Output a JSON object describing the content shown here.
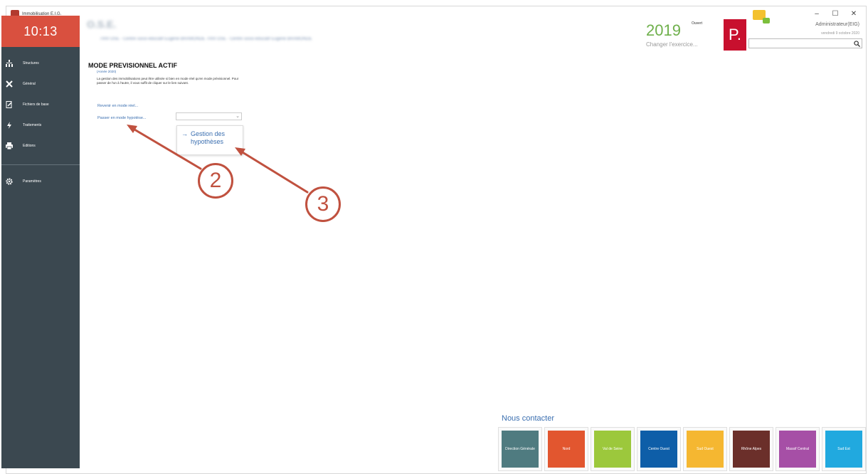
{
  "window": {
    "title": "Immobilisation E.I.G.",
    "controls": [
      "–",
      "☐",
      "✕"
    ]
  },
  "sidebar": {
    "clock": "10:13",
    "items": [
      {
        "label": "Structures",
        "icon": "structure-icon"
      },
      {
        "label": "Général",
        "icon": "tools-icon"
      },
      {
        "label": "Fichiers de base",
        "icon": "edit-file-icon"
      },
      {
        "label": "Traitements",
        "icon": "lightning-icon"
      },
      {
        "label": "Editions",
        "icon": "printer-icon"
      },
      {
        "label": "Paramètres",
        "icon": "gear-icon"
      }
    ]
  },
  "header": {
    "company_name": "O.S.E.",
    "company_subtitle": "7000 OSE - Centre socio-éducatif Eugène BRAMONDE 7000 OSE - Centre socio-éducatif Eugène BRAMONDE",
    "year": "2019",
    "year_status": "Ouvert",
    "change_year": "Changer l'exercice...",
    "logo_letter": "P.",
    "user": "Administrateur(EIG)",
    "date": "vendredi 9 octobre 2020",
    "search_value": ""
  },
  "main": {
    "title": "MODE PREVISIONNEL ACTIF",
    "year_note": "(Année 2020)",
    "description": "La gestion des immobilisations peut être utilisée si bien en mode réel qu'en mode prévisionnel. Pour passer de l'un à l'autre, il vous suffit de cliquer sur le lien suivant.",
    "link_real": "Revenir en mode réel...",
    "link_hypo": "Passer en mode hypotèse...",
    "select_value": "",
    "dropdown_item": "Gestion des hypothèses"
  },
  "annotations": {
    "callout_2": "2",
    "callout_3": "3",
    "color": "#c0513f"
  },
  "contact": {
    "title": "Nous contacter",
    "tiles": [
      {
        "label": "Direction Générale",
        "color": "#4f7b80"
      },
      {
        "label": "Nord",
        "color": "#e2562f"
      },
      {
        "label": "Val de Seine",
        "color": "#9cc83c"
      },
      {
        "label": "Centre Ouest",
        "color": "#0e5ea8"
      },
      {
        "label": "Sud Ouest",
        "color": "#f5b731"
      },
      {
        "label": "Rhône Alpes",
        "color": "#6b2f2a"
      },
      {
        "label": "Massif Central",
        "color": "#a64fa6"
      },
      {
        "label": "Sud Est",
        "color": "#21a9df"
      }
    ]
  }
}
